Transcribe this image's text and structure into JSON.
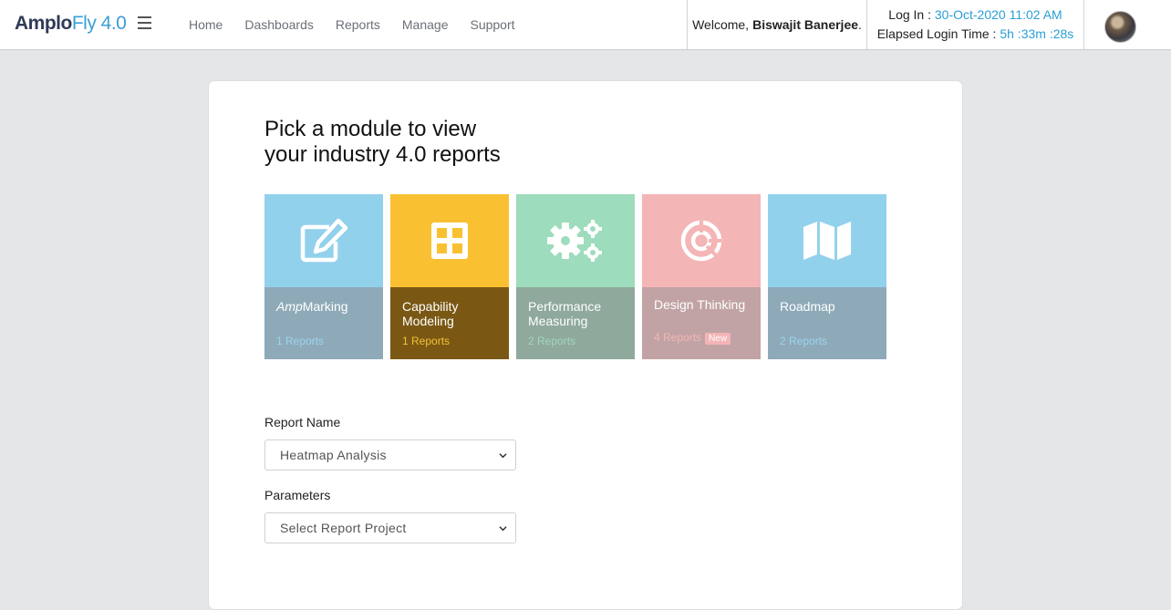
{
  "brand": {
    "part1": "Amplo",
    "part2": "Fly 4.0"
  },
  "nav": [
    "Home",
    "Dashboards",
    "Reports",
    "Manage",
    "Support"
  ],
  "user": {
    "welcome_prefix": "Welcome,",
    "name": "Biswajit Banerjee",
    "suffix": "."
  },
  "session": {
    "login_label": "Log In :",
    "login_value": "30-Oct-2020 11:02 AM",
    "elapsed_label": "Elapsed Login Time :",
    "elapsed_value": "5h :33m :28s"
  },
  "page": {
    "heading_line1": "Pick a module to view",
    "heading_line2": "your industry 4.0 reports"
  },
  "modules": [
    {
      "title_em": "Amp",
      "title": "Marking",
      "count": "1 Reports",
      "icon": "edit-icon"
    },
    {
      "title_em": "",
      "title": "Capability Modeling",
      "count": "1 Reports",
      "icon": "grid-icon"
    },
    {
      "title_em": "",
      "title": "Performance Measuring",
      "count": "2 Reports",
      "icon": "gears-icon"
    },
    {
      "title_em": "",
      "title": "Design Thinking",
      "count": "4 Reports",
      "badge": "New",
      "icon": "pie-icon"
    },
    {
      "title_em": "",
      "title": "Roadmap",
      "count": "2 Reports",
      "icon": "map-icon"
    }
  ],
  "form": {
    "report_name_label": "Report Name",
    "report_name_value": "Heatmap Analysis",
    "parameters_label": "Parameters",
    "parameters_value": "Select Report Project"
  },
  "colors": {
    "accent": "#2a9fd6",
    "brand_dark": "#2f3a56",
    "page_bg": "#e5e6e8"
  }
}
